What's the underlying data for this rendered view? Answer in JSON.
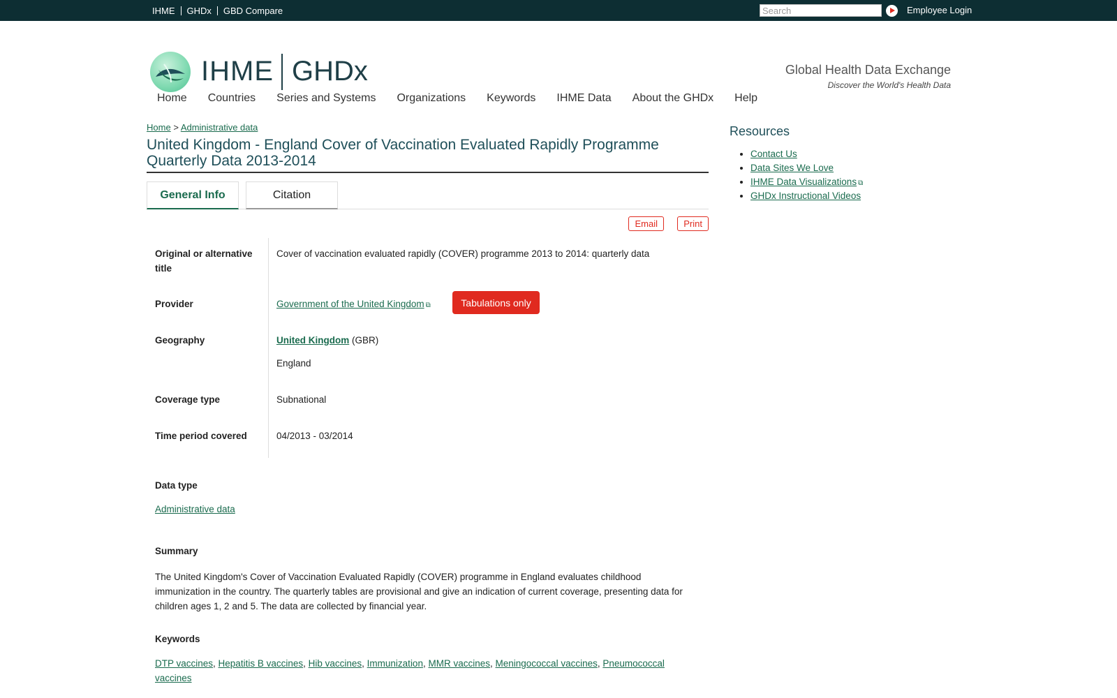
{
  "topbar": {
    "links": [
      "IHME",
      "GHDx",
      "GBD Compare"
    ],
    "search_placeholder": "Search",
    "login": "Employee Login"
  },
  "header": {
    "logo_ihme": "IHME",
    "logo_ghdx": "GHDx",
    "tagline": "Global Health Data Exchange",
    "sub_tagline": "Discover the World's Health Data"
  },
  "nav": [
    "Home",
    "Countries",
    "Series and Systems",
    "Organizations",
    "Keywords",
    "IHME Data",
    "About the GHDx",
    "Help"
  ],
  "breadcrumb": {
    "home": "Home",
    "sep": ">",
    "current": "Administrative data"
  },
  "page_title": "United Kingdom - England Cover of Vaccination Evaluated Rapidly Programme Quarterly Data 2013-2014",
  "tabs": {
    "general": "General Info",
    "citation": "Citation"
  },
  "actions": {
    "email": "Email",
    "print": "Print"
  },
  "fields": {
    "alt_title_label": "Original or alternative title",
    "alt_title_value": "Cover of vaccination evaluated rapidly (COVER) programme 2013 to 2014: quarterly data",
    "provider_label": "Provider",
    "provider_value": "Government of the United Kingdom",
    "badge": "Tabulations only",
    "geography_label": "Geography",
    "geography_country": "United Kingdom",
    "geography_code": "(GBR)",
    "geography_region": "England",
    "coverage_label": "Coverage type",
    "coverage_value": "Subnational",
    "time_label": "Time period covered",
    "time_value": "04/2013 - 03/2014"
  },
  "data_type": {
    "label": "Data type",
    "value": "Administrative data"
  },
  "summary": {
    "label": "Summary",
    "text": "The United Kingdom's Cover of Vaccination Evaluated Rapidly (COVER) programme in England evaluates childhood immunization in the country. The quarterly tables are provisional and give an indication of current coverage, presenting data for children ages 1, 2 and 5. The data are collected by financial year."
  },
  "keywords": {
    "label": "Keywords",
    "items": [
      "DTP vaccines",
      "Hepatitis B vaccines",
      "Hib vaccines",
      "Immunization",
      "MMR vaccines",
      "Meningococcal vaccines",
      "Pneumococcal vaccines"
    ]
  },
  "resources": {
    "title": "Resources",
    "items": [
      "Contact Us",
      "Data Sites We Love",
      "IHME Data Visualizations",
      "GHDx Instructional Videos"
    ]
  },
  "colors": {
    "accent_green": "#1a6b4e",
    "topbar": "#0d2e33",
    "red": "#e02a1f"
  }
}
